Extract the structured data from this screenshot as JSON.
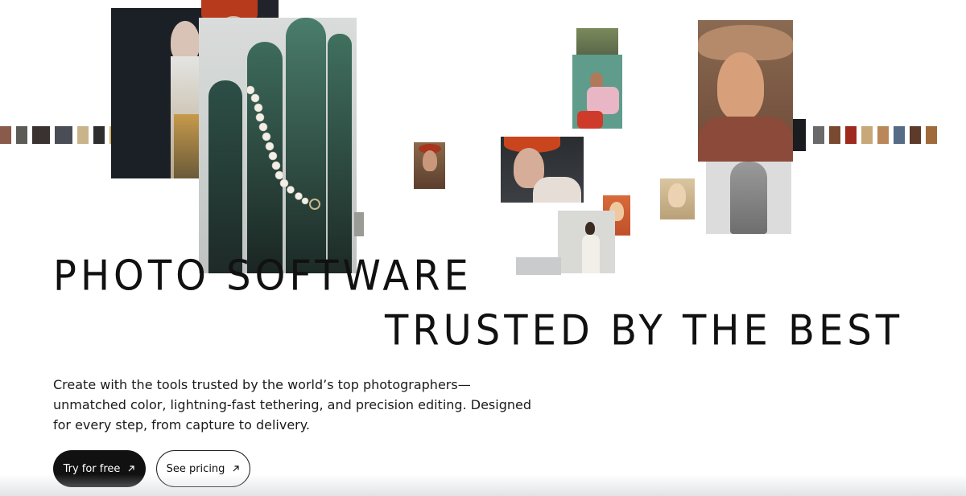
{
  "hero": {
    "headline_line1": "PHOTO SOFTWARE",
    "headline_line2": "TRUSTED BY THE BEST",
    "description": "Create with the tools trusted by the world’s top photographers— unmatched color, lightning-fast tethering, and precision editing. Designed for every step, from capture to delivery."
  },
  "actions": {
    "primary_label": "Try for free",
    "secondary_label": "See pricing",
    "primary_icon": "arrow-up-right-icon",
    "secondary_icon": "arrow-up-right-icon"
  },
  "colors": {
    "text": "#111111",
    "primary_button_bg": "#111111",
    "primary_button_text": "#ffffff",
    "secondary_button_border": "#222222"
  }
}
